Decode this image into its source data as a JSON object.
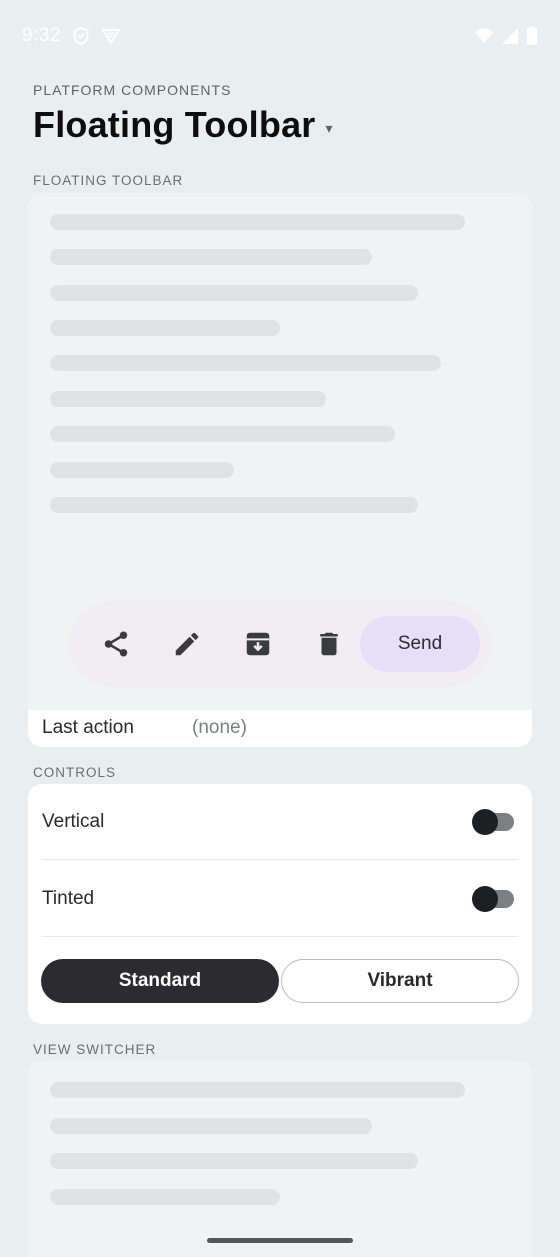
{
  "status": {
    "time": "9:32",
    "left_icons": [
      "shield-icon",
      "vpn-icon"
    ],
    "right_icons": [
      "wifi-icon",
      "signal-icon",
      "battery-icon"
    ]
  },
  "header": {
    "eyebrow": "PLATFORM COMPONENTS",
    "title": "Floating Toolbar",
    "caret": "▾"
  },
  "sections": {
    "floating_toolbar": "FLOATING TOOLBAR",
    "controls": "CONTROLS",
    "view_switcher": "VIEW SWITCHER"
  },
  "toolbar": {
    "icons": [
      "share-icon",
      "edit-icon",
      "archive-icon",
      "delete-icon"
    ],
    "send_label": "Send"
  },
  "last_action": {
    "label": "Last action",
    "value": "(none)"
  },
  "controls": {
    "vertical": {
      "label": "Vertical",
      "on": false
    },
    "tinted": {
      "label": "Tinted",
      "on": false
    },
    "styles": [
      {
        "label": "Standard",
        "selected": true
      },
      {
        "label": "Vibrant",
        "selected": false
      }
    ]
  },
  "colors": {
    "background": "#e9eeee",
    "card": "#ffffff",
    "preview": "#eff3f3",
    "skeleton": "#dfe3e4",
    "toolbar": "#f1edf3",
    "send": "#e7dff6",
    "standard_selected": "#2c2b2f"
  }
}
